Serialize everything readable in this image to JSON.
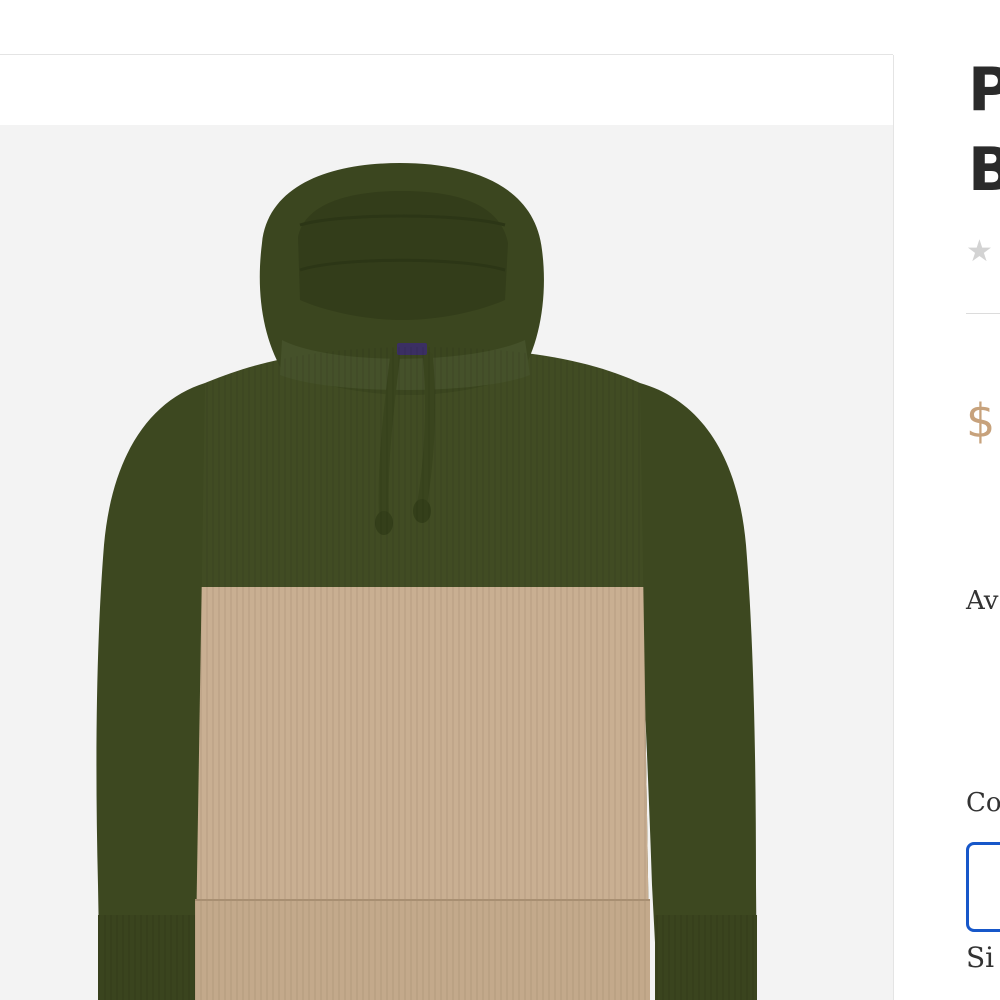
{
  "product": {
    "title_line_1": "P",
    "title_line_2": "B",
    "rating_icon": "star-icon",
    "price": "$",
    "availability_label": "Av",
    "color_label": "Co",
    "size_label": "Si"
  },
  "gallery": {
    "image_subject": "knit hooded pullover sweater",
    "colors": {
      "background": "#f3f3f3",
      "upper_body": "#3f4a22",
      "lower_body": "#c7ad90",
      "accent_price": "#c7a27c",
      "swatch_border": "#1757c9"
    }
  }
}
